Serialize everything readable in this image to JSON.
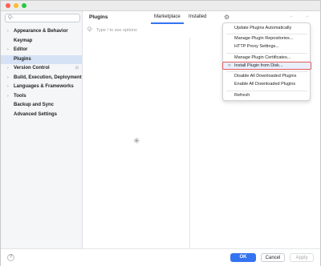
{
  "sidebar": {
    "search_icon": "Q-",
    "items": [
      {
        "label": "Appearance & Behavior",
        "chevron": "›",
        "extra": ""
      },
      {
        "label": "Keymap",
        "chevron": "",
        "extra": ""
      },
      {
        "label": "Editor",
        "chevron": "›",
        "extra": ""
      },
      {
        "label": "Plugins",
        "chevron": "",
        "extra": ""
      },
      {
        "label": "Version Control",
        "chevron": "›",
        "extra": "⊟"
      },
      {
        "label": "Build, Execution, Deployment",
        "chevron": "›",
        "extra": ""
      },
      {
        "label": "Languages & Frameworks",
        "chevron": "›",
        "extra": ""
      },
      {
        "label": "Tools",
        "chevron": "›",
        "extra": ""
      },
      {
        "label": "Backup and Sync",
        "chevron": "",
        "extra": ""
      },
      {
        "label": "Advanced Settings",
        "chevron": "",
        "extra": ""
      }
    ]
  },
  "header": {
    "title": "Plugins",
    "tabs": [
      "Marketplace",
      "Installed"
    ],
    "gear_icon": "⚙",
    "back_forward": "← →"
  },
  "plugin_search": {
    "icon": "Q-",
    "placeholder": "Type / to see options"
  },
  "spinner_glyph": "✳",
  "menu": {
    "items": [
      "Update Plugins Automatically",
      "Manage Plugin Repositories...",
      "HTTP Proxy Settings...",
      "Manage Plugin Certificates...",
      "Install Plugin from Disk...",
      "Disable All Downloaded Plugins",
      "Enable All Downloaded Plugins",
      "Refresh"
    ],
    "highlight_marker": "○"
  },
  "footer": {
    "help": "?",
    "ok": "OK",
    "cancel": "Cancel",
    "apply": "Apply"
  },
  "colors": {
    "accent": "#3574f0",
    "selection": "#d5e1f5",
    "highlight_border": "#e05a5a"
  }
}
